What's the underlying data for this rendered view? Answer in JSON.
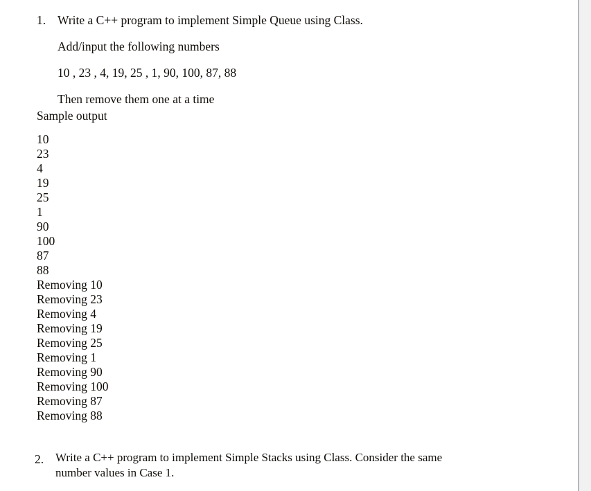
{
  "document": {
    "background_color": "#ffffff",
    "app_background_color": "#f1f1f1",
    "page_border_color": "#b5b8c0",
    "text_color": "#100c08"
  },
  "questions": [
    {
      "marker": "1.",
      "lines": [
        "Write a C++ program to implement Simple Queue using Class.",
        "Add/input the following numbers",
        "10 , 23 , 4, 19, 25 , 1, 90, 100, 87, 88",
        "Then remove them one at a time"
      ]
    },
    {
      "marker": "2.",
      "lines": [
        "Write a C++ program to implement Simple Stacks using Class. Consider the same",
        "number values in Case 1."
      ]
    }
  ],
  "sample_output": {
    "heading": "Sample output",
    "lines": [
      "10",
      "23",
      "4",
      "19",
      "25",
      "1",
      "90",
      "100",
      "87",
      "88",
      "Removing 10",
      "Removing 23",
      "Removing 4",
      "Removing 19",
      "Removing 25",
      "Removing 1",
      "Removing 90",
      "Removing 100",
      "Removing 87",
      "Removing 88"
    ]
  }
}
